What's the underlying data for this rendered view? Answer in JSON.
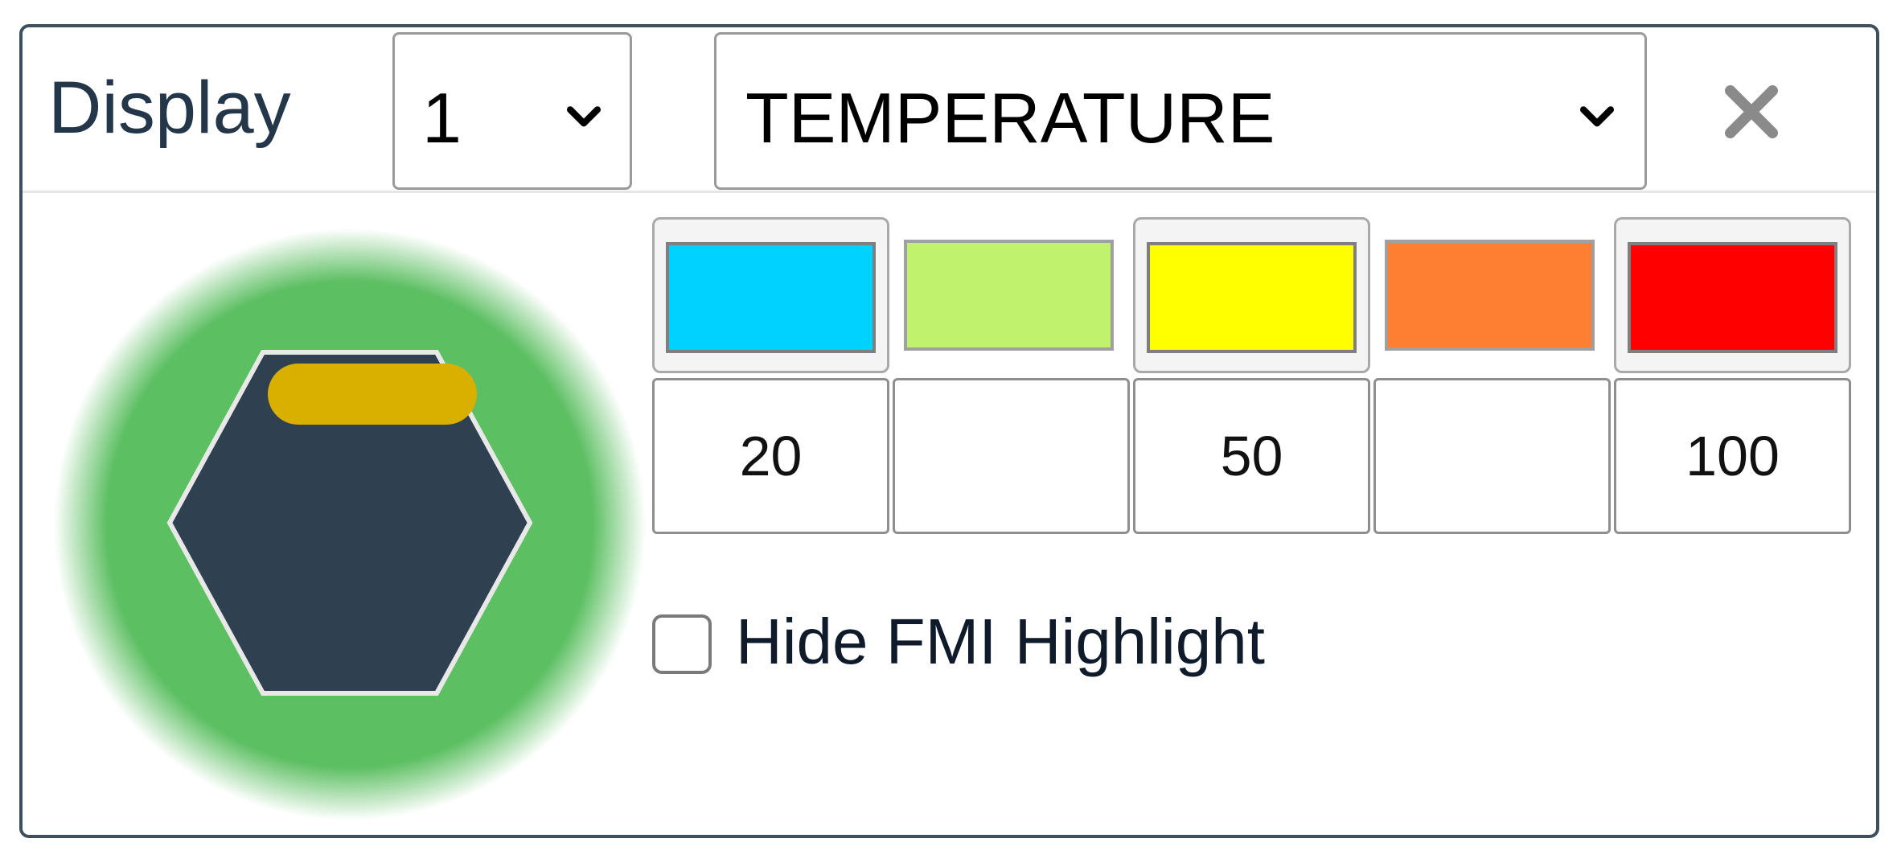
{
  "header": {
    "display_label": "Display",
    "display_select_value": "1",
    "metric_select_value": "TEMPERATURE",
    "close_icon": "close-icon"
  },
  "preview": {
    "icon": "hexagon-icon",
    "glow_color": "#5cbf62",
    "hexagon_color": "#2f4150",
    "indicator_color": "#d9b000"
  },
  "scale": {
    "swatches": [
      {
        "color": "#00d2ff",
        "selected": true
      },
      {
        "color": "#c0f26e",
        "selected": false
      },
      {
        "color": "#ffff00",
        "selected": true
      },
      {
        "color": "#ff7f32",
        "selected": false
      },
      {
        "color": "#ff0000",
        "selected": true
      }
    ],
    "values": [
      "20",
      "",
      "50",
      "",
      "100"
    ]
  },
  "options": {
    "hide_fmi_highlight_label": "Hide FMI Highlight",
    "hide_fmi_highlight_checked": false
  }
}
